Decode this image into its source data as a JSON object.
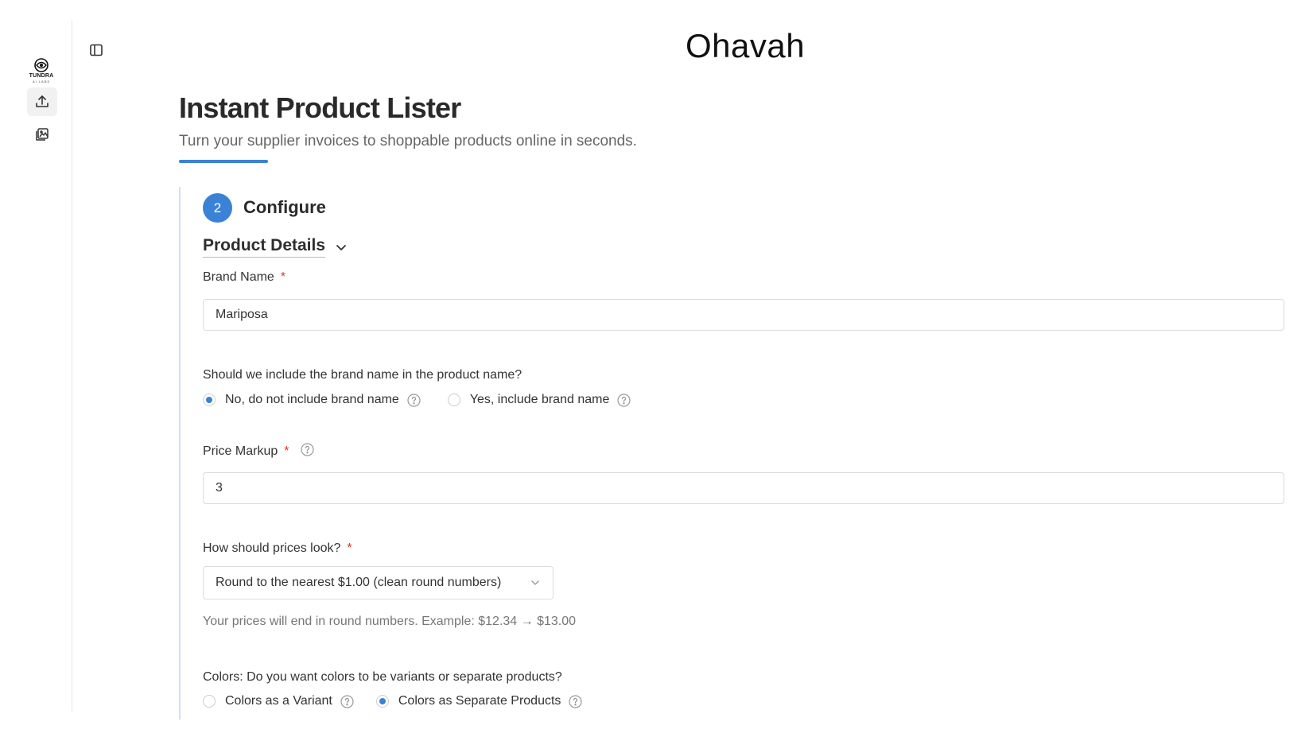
{
  "rail": {
    "logo_text": "TUNDRA",
    "logo_sub": "AI LABS",
    "items": [
      {
        "icon": "upload-icon"
      },
      {
        "icon": "image-gallery-icon"
      }
    ]
  },
  "brand": {
    "name": "Ohavah"
  },
  "header": {
    "title": "Instant Product Lister",
    "subtitle": "Turn your supplier invoices to shoppable products online in seconds."
  },
  "step": {
    "number": "2",
    "title": "Configure"
  },
  "section": {
    "title": "Product Details"
  },
  "brand_name": {
    "label": "Brand Name",
    "required": "*",
    "value": "Mariposa"
  },
  "include_brand": {
    "question": "Should we include the brand name in the product name?",
    "options": [
      {
        "label": "No, do not include brand name",
        "selected": true
      },
      {
        "label": "Yes, include brand name",
        "selected": false
      }
    ]
  },
  "price_markup": {
    "label": "Price Markup",
    "required": "*",
    "value": "3"
  },
  "price_look": {
    "label": "How should prices look?",
    "required": "*",
    "selected": "Round to the nearest $1.00 (clean round numbers)",
    "hint": "Your prices will end in round numbers. Example: $12.34 → $13.00"
  },
  "colors": {
    "question": "Colors: Do you want colors to be variants or separate products?",
    "options": [
      {
        "label": "Colors as a Variant",
        "selected": false
      },
      {
        "label": "Colors as Separate Products",
        "selected": true
      }
    ]
  },
  "accent_color": "#3b82d6"
}
